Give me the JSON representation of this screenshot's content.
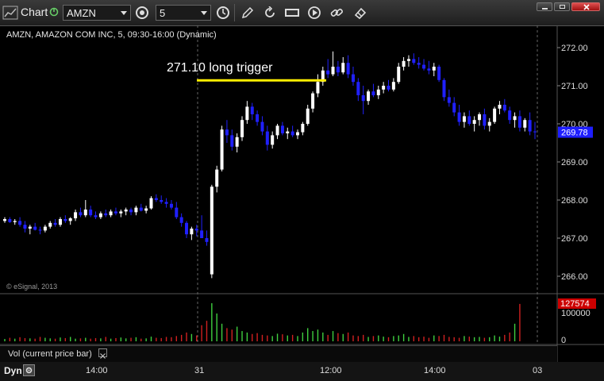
{
  "toolbar": {
    "title": "Chart",
    "symbol": "AMZN",
    "interval": "5"
  },
  "chart": {
    "header": "AMZN, AMAZON COM INC, 5, 09:30-16:00 (Dynamic)",
    "watermark": "© eSignal, 2013",
    "annotation": "271.10 long trigger",
    "trigger_price": 271.1,
    "last_price_label": "269.78",
    "y_labels": [
      "272.00",
      "271.00",
      "270.00",
      "269.00",
      "268.00",
      "267.00",
      "266.00"
    ],
    "y_values": [
      272,
      271,
      270,
      269,
      268,
      267,
      266
    ],
    "colors": {
      "up": "#ffffff",
      "down": "#2020ff",
      "trigger_line": "#ffee00",
      "last_price_bg": "#1e1eff",
      "vol_up": "#3fcf3f",
      "vol_down": "#d22020",
      "vol_last_bg": "#cc0000"
    }
  },
  "volume": {
    "last_label": "127574",
    "y_labels": [
      "100000",
      "0"
    ],
    "study_label": "Vol (current price bar)"
  },
  "time_axis": {
    "mode_label": "Dyn",
    "labels": [
      "14:00",
      "31",
      "12:00",
      "14:00",
      "03"
    ]
  },
  "chart_data": {
    "type": "candlestick",
    "series_note": "5-minute candles, OHLC; volume in shares",
    "candles": [
      [
        267.45,
        267.55,
        267.4,
        267.5
      ],
      [
        267.5,
        267.55,
        267.4,
        267.42
      ],
      [
        267.42,
        267.5,
        267.35,
        267.45
      ],
      [
        267.45,
        267.55,
        267.3,
        267.35
      ],
      [
        267.35,
        267.45,
        267.15,
        267.25
      ],
      [
        267.25,
        267.35,
        267.1,
        267.3
      ],
      [
        267.3,
        267.4,
        267.2,
        267.22
      ],
      [
        267.22,
        267.3,
        267.1,
        267.2
      ],
      [
        267.2,
        267.35,
        267.15,
        267.3
      ],
      [
        267.3,
        267.45,
        267.25,
        267.4
      ],
      [
        267.4,
        267.5,
        267.3,
        267.35
      ],
      [
        267.35,
        267.55,
        267.3,
        267.5
      ],
      [
        267.5,
        267.6,
        267.4,
        267.45
      ],
      [
        267.45,
        267.55,
        267.35,
        267.52
      ],
      [
        267.52,
        267.75,
        267.45,
        267.68
      ],
      [
        267.68,
        267.8,
        267.55,
        267.6
      ],
      [
        267.6,
        268.0,
        267.55,
        267.75
      ],
      [
        267.75,
        267.85,
        267.55,
        267.6
      ],
      [
        267.6,
        267.7,
        267.5,
        267.55
      ],
      [
        267.55,
        267.7,
        267.5,
        267.65
      ],
      [
        267.65,
        267.75,
        267.55,
        267.6
      ],
      [
        267.6,
        267.75,
        267.55,
        267.7
      ],
      [
        267.7,
        267.8,
        267.6,
        267.65
      ],
      [
        267.65,
        267.75,
        267.55,
        267.7
      ],
      [
        267.7,
        267.8,
        267.6,
        267.75
      ],
      [
        267.75,
        267.8,
        267.6,
        267.68
      ],
      [
        267.68,
        267.85,
        267.6,
        267.8
      ],
      [
        267.8,
        267.9,
        267.7,
        267.72
      ],
      [
        267.72,
        267.85,
        267.65,
        267.78
      ],
      [
        267.78,
        268.1,
        267.75,
        268.05
      ],
      [
        268.05,
        268.15,
        267.95,
        268.0
      ],
      [
        268.0,
        268.12,
        267.9,
        267.95
      ],
      [
        267.95,
        268.05,
        267.8,
        267.9
      ],
      [
        267.9,
        268.0,
        267.75,
        267.8
      ],
      [
        267.8,
        267.95,
        267.5,
        267.55
      ],
      [
        267.55,
        267.65,
        267.3,
        267.4
      ],
      [
        267.4,
        267.45,
        267.0,
        267.1
      ],
      [
        267.1,
        267.3,
        266.95,
        267.25
      ],
      [
        267.25,
        267.35,
        267.05,
        267.2
      ],
      [
        267.2,
        267.6,
        267.15,
        267.0
      ],
      [
        267.0,
        267.2,
        266.8,
        266.9
      ],
      [
        266.05,
        268.4,
        265.95,
        268.35
      ],
      [
        268.35,
        268.9,
        268.2,
        268.8
      ],
      [
        268.8,
        269.95,
        268.75,
        269.85
      ],
      [
        269.85,
        270.1,
        269.5,
        269.7
      ],
      [
        269.7,
        269.85,
        269.3,
        269.4
      ],
      [
        269.4,
        269.75,
        269.25,
        269.65
      ],
      [
        269.65,
        270.2,
        269.55,
        270.1
      ],
      [
        270.1,
        270.6,
        270.0,
        270.45
      ],
      [
        270.45,
        270.55,
        270.1,
        270.25
      ],
      [
        270.25,
        270.35,
        269.95,
        270.05
      ],
      [
        270.05,
        270.2,
        269.7,
        269.8
      ],
      [
        269.8,
        269.95,
        269.3,
        269.45
      ],
      [
        269.45,
        269.8,
        269.35,
        269.7
      ],
      [
        269.7,
        270.0,
        269.6,
        269.95
      ],
      [
        269.95,
        270.05,
        269.7,
        269.75
      ],
      [
        269.75,
        269.9,
        269.6,
        269.8
      ],
      [
        269.8,
        269.95,
        269.65,
        269.7
      ],
      [
        269.7,
        269.85,
        269.6,
        269.78
      ],
      [
        269.78,
        270.05,
        269.7,
        270.0
      ],
      [
        270.0,
        270.5,
        269.95,
        270.4
      ],
      [
        270.4,
        270.85,
        270.3,
        270.8
      ],
      [
        270.8,
        271.3,
        270.7,
        271.1
      ],
      [
        271.1,
        271.5,
        271.0,
        271.4
      ],
      [
        271.4,
        271.7,
        271.2,
        271.3
      ],
      [
        271.3,
        271.9,
        271.25,
        271.5
      ],
      [
        271.5,
        271.65,
        271.25,
        271.35
      ],
      [
        271.35,
        271.75,
        271.3,
        271.6
      ],
      [
        271.6,
        271.8,
        271.2,
        271.3
      ],
      [
        271.3,
        271.5,
        271.0,
        271.1
      ],
      [
        271.1,
        271.2,
        270.6,
        270.75
      ],
      [
        270.75,
        271.0,
        270.25,
        270.6
      ],
      [
        270.6,
        270.9,
        270.5,
        270.85
      ],
      [
        270.85,
        271.05,
        270.7,
        270.75
      ],
      [
        270.75,
        271.0,
        270.65,
        270.9
      ],
      [
        270.9,
        271.1,
        270.8,
        271.0
      ],
      [
        271.0,
        271.15,
        270.85,
        270.9
      ],
      [
        270.9,
        271.2,
        270.85,
        271.1
      ],
      [
        271.1,
        271.6,
        271.05,
        271.5
      ],
      [
        271.5,
        271.75,
        271.4,
        271.65
      ],
      [
        271.65,
        271.8,
        271.5,
        271.7
      ],
      [
        271.7,
        271.85,
        271.55,
        271.6
      ],
      [
        271.6,
        271.75,
        271.45,
        271.55
      ],
      [
        271.55,
        271.7,
        271.4,
        271.45
      ],
      [
        271.45,
        271.65,
        271.3,
        271.4
      ],
      [
        271.4,
        271.6,
        271.25,
        271.5
      ],
      [
        271.5,
        271.55,
        271.1,
        271.15
      ],
      [
        271.15,
        271.2,
        270.6,
        270.7
      ],
      [
        270.7,
        270.9,
        270.45,
        270.55
      ],
      [
        270.55,
        270.7,
        270.2,
        270.3
      ],
      [
        270.3,
        270.5,
        269.95,
        270.05
      ],
      [
        270.05,
        270.3,
        269.9,
        270.2
      ],
      [
        270.2,
        270.35,
        269.95,
        270.0
      ],
      [
        270.0,
        270.2,
        269.8,
        270.1
      ],
      [
        270.1,
        270.3,
        269.95,
        270.25
      ],
      [
        270.25,
        270.4,
        269.85,
        269.95
      ],
      [
        269.95,
        270.15,
        269.8,
        270.05
      ],
      [
        270.05,
        270.45,
        270.0,
        270.4
      ],
      [
        270.4,
        270.6,
        270.25,
        270.5
      ],
      [
        270.5,
        270.65,
        270.3,
        270.35
      ],
      [
        270.35,
        270.45,
        270.0,
        270.1
      ],
      [
        270.1,
        270.3,
        269.9,
        270.2
      ],
      [
        270.2,
        270.35,
        269.8,
        269.9
      ],
      [
        269.9,
        270.15,
        269.8,
        270.1
      ],
      [
        270.1,
        270.3,
        269.7,
        269.8
      ],
      [
        269.8,
        270.05,
        269.6,
        269.78
      ]
    ],
    "volume": [
      8000,
      12000,
      9000,
      14000,
      11000,
      10000,
      9000,
      15000,
      12000,
      10000,
      9000,
      13000,
      11000,
      15000,
      9000,
      10000,
      12000,
      9000,
      11000,
      10000,
      15000,
      9000,
      11000,
      13000,
      10000,
      12000,
      14000,
      9000,
      10000,
      16000,
      12000,
      11000,
      15000,
      14000,
      18000,
      22000,
      30000,
      25000,
      20000,
      55000,
      70000,
      130000,
      95000,
      60000,
      45000,
      40000,
      50000,
      35000,
      30000,
      25000,
      28000,
      22000,
      20000,
      18000,
      26000,
      24000,
      20000,
      22000,
      18000,
      30000,
      45000,
      35000,
      40000,
      30000,
      22000,
      35000,
      28000,
      25000,
      30000,
      20000,
      18000,
      22000,
      15000,
      18000,
      20000,
      16000,
      14000,
      18000,
      20000,
      25000,
      15000,
      18000,
      14000,
      16000,
      12000,
      20000,
      18000,
      22000,
      15000,
      14000,
      12000,
      18000,
      16000,
      14000,
      15000,
      12000,
      14000,
      20000,
      16000,
      22000,
      30000,
      60000,
      127574
    ]
  }
}
